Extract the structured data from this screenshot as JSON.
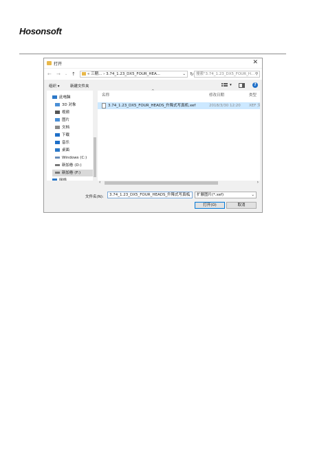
{
  "header": {
    "logo_text": "Hosonsoft"
  },
  "dialog": {
    "title": "打开",
    "close_glyph": "✕",
    "nav": {
      "back": "←",
      "forward": "→",
      "down": "⌄",
      "up": "↑"
    },
    "address": {
      "prefix": "«",
      "path_parent": "三期...",
      "sep": "›",
      "path_current": "3.74_1.23_DX5_FOUR_HEA...",
      "dropdown": "⌄"
    },
    "refresh_glyph": "↻",
    "search_placeholder": "搜索\"3.74_1.23_DX5_FOUR_H...",
    "search_glyph": "⚲",
    "toolbar": {
      "organize": "组织 ▾",
      "new_folder": "新建文件夹",
      "help": "?"
    },
    "sidebar": {
      "items": [
        {
          "label": "此电脑",
          "icon": "computer-icon",
          "color": "#2b78c8"
        },
        {
          "label": "3D 对象",
          "icon": "cube-icon",
          "color": "#4a8fd6"
        },
        {
          "label": "视频",
          "icon": "video-icon",
          "color": "#555555"
        },
        {
          "label": "图片",
          "icon": "picture-icon",
          "color": "#4a8fd6"
        },
        {
          "label": "文档",
          "icon": "document-icon",
          "color": "#8a8a8a"
        },
        {
          "label": "下载",
          "icon": "download-icon",
          "color": "#1e6fc8"
        },
        {
          "label": "音乐",
          "icon": "music-icon",
          "color": "#1e6fc8"
        },
        {
          "label": "桌面",
          "icon": "desktop-icon",
          "color": "#2b78c8"
        },
        {
          "label": "Windows (C:)",
          "icon": "drive-icon",
          "color": "#6a8db8"
        },
        {
          "label": "新加卷 (D:)",
          "icon": "drive-icon",
          "color": "#777777"
        },
        {
          "label": "新加卷 (F:)",
          "icon": "drive-icon",
          "color": "#777777"
        },
        {
          "label": "网络",
          "icon": "network-icon",
          "color": "#2b78c8"
        }
      ]
    },
    "columns": {
      "name": "名称",
      "sort_glyph": "^",
      "date": "修改日期",
      "type": "类型"
    },
    "files": [
      {
        "name": "3.74_1.23_DX5_FOUR_HEADS_升降式写真机.xef",
        "date": "2018/3/30 12:20",
        "type": "XEF 文"
      }
    ],
    "hscroll": {
      "left": "‹",
      "right": "›"
    },
    "filename_label": "文件名(N):",
    "filename_value": "3.74_1.23_DX5_FOUR_HEADS_升降式写真机",
    "filter_value": "扩展图片(*.xef)",
    "open_button": "打开(O)",
    "cancel_button": "取消"
  }
}
